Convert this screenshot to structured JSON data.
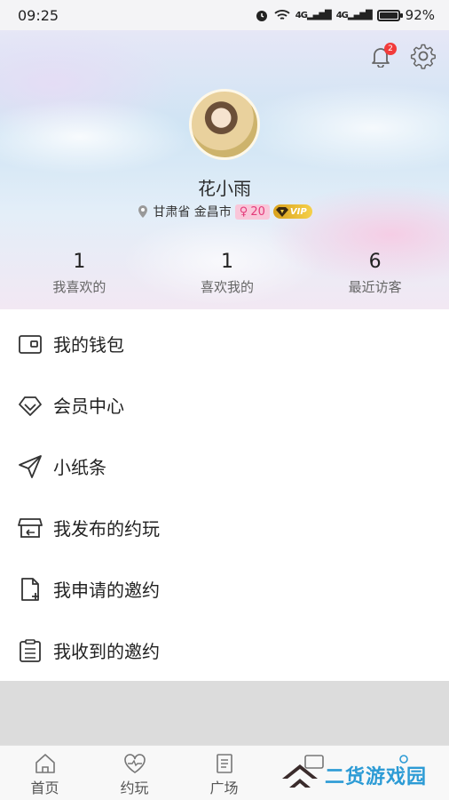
{
  "status_bar": {
    "time": "09:25",
    "signal1": "4G",
    "signal2": "4G",
    "battery_text": "92%",
    "battery_level": 0.92
  },
  "header": {
    "notification_count": "2",
    "username": "花小雨",
    "location": "甘肃省 金昌市",
    "gender_symbol": "♀",
    "age": "20",
    "vip_label": "VIP",
    "colors": {
      "age_badge_bg": "#f9c6d9",
      "age_badge_fg": "#e33a7a",
      "vip_gold": "#e3b22e",
      "badge_red": "#f23b3b"
    }
  },
  "stats": [
    {
      "value": "1",
      "label": "我喜欢的"
    },
    {
      "value": "1",
      "label": "喜欢我的"
    },
    {
      "value": "6",
      "label": "最近访客"
    }
  ],
  "menu": [
    {
      "label": "我的钱包",
      "icon": "wallet-icon"
    },
    {
      "label": "会员中心",
      "icon": "diamond-icon"
    },
    {
      "label": "小纸条",
      "icon": "send-icon"
    },
    {
      "label": "我发布的约玩",
      "icon": "store-icon"
    },
    {
      "label": "我申请的邀约",
      "icon": "file-add-icon"
    },
    {
      "label": "我收到的邀约",
      "icon": "clipboard-icon"
    }
  ],
  "bottom_nav": [
    {
      "label": "首页",
      "icon": "home-icon"
    },
    {
      "label": "约玩",
      "icon": "heart-pulse-icon"
    },
    {
      "label": "广场",
      "icon": "document-icon"
    },
    {
      "label": "",
      "icon": "message-icon"
    },
    {
      "label": "",
      "icon": "profile-icon"
    }
  ],
  "watermark": {
    "text": "二货游戏园"
  }
}
